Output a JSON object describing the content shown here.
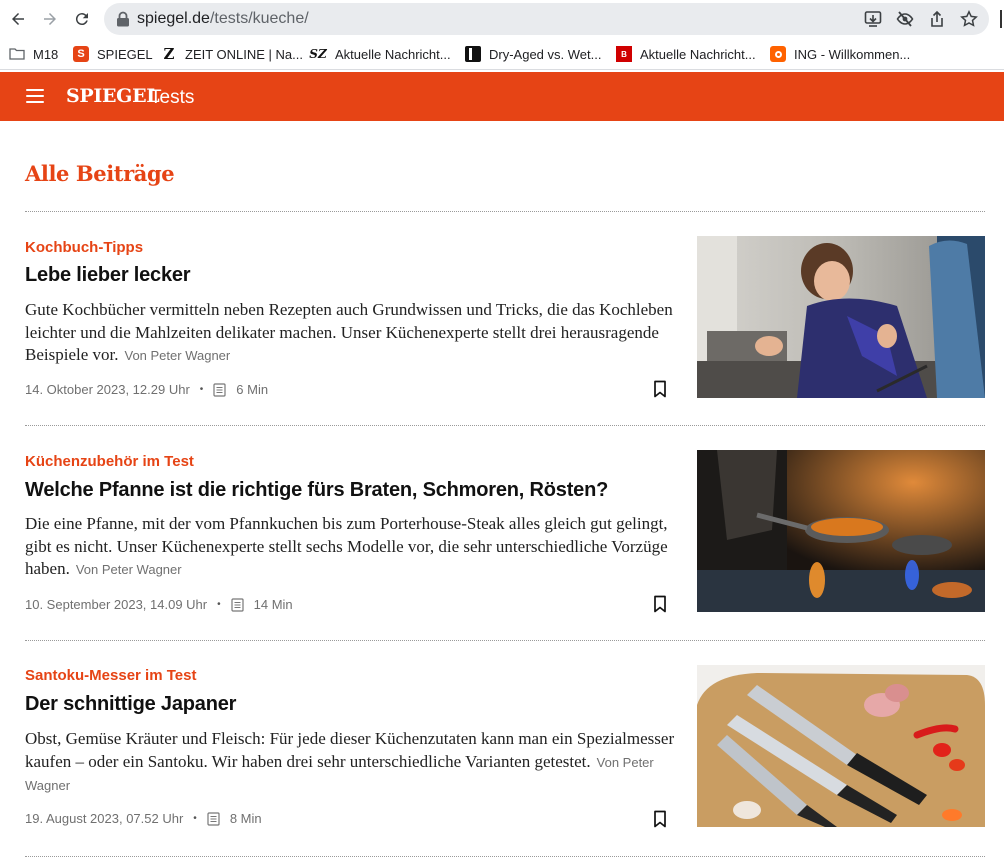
{
  "browser": {
    "url_host": "spiegel.de",
    "url_path": "/tests/kueche/",
    "bookmarks": [
      {
        "label": "M18",
        "icon": "folder-icon"
      },
      {
        "label": "SPIEGEL",
        "icon": "spiegel-favicon",
        "color": "#e64415"
      },
      {
        "label": "ZEIT ONLINE | Na...",
        "icon": "zeit-favicon"
      },
      {
        "label": "Aktuelle Nachricht...",
        "icon": "sz-favicon"
      },
      {
        "label": "Dry-Aged vs. Wet...",
        "icon": "book-favicon"
      },
      {
        "label": "Aktuelle Nachricht...",
        "icon": "bild-favicon",
        "color": "#d00000"
      },
      {
        "label": "ING - Willkommen...",
        "icon": "ing-favicon",
        "color": "#ff6200"
      }
    ]
  },
  "header": {
    "logo": "SPIEGEL",
    "section": "Tests",
    "color": "#e64415"
  },
  "page": {
    "title": "Alle Beiträge"
  },
  "articles": [
    {
      "kicker": "Kochbuch-Tipps",
      "headline": "Lebe lieber lecker",
      "teaser": "Gute Kochbücher vermitteln neben Rezepten auch Grundwissen und Tricks, die das Kochleben leichter und die Mahlzeiten delikater machen. Unser Küchenexperte stellt drei herausragende Beispiele vor.",
      "author": "Von Peter Wagner",
      "date": "14. Oktober 2023, 12.29 Uhr",
      "read_time": "6 Min",
      "image": "woman-cooking-photo"
    },
    {
      "kicker": "Küchenzubehör im Test",
      "headline": "Welche Pfanne ist die richtige fürs Braten, Schmoren, Rösten?",
      "teaser": "Die eine Pfanne, mit der vom Pfannkuchen bis zum Porterhouse-Steak alles gleich gut gelingt, gibt es nicht. Unser Küchenexperte stellt sechs Modelle vor, die sehr unterschiedliche Vorzüge haben.",
      "author": "Von Peter Wagner",
      "date": "10. September 2023, 14.09 Uhr",
      "read_time": "14 Min",
      "image": "pan-on-flame-photo"
    },
    {
      "kicker": "Santoku-Messer im Test",
      "headline": "Der schnittige Japaner",
      "teaser": "Obst, Gemüse Kräuter und Fleisch: Für jede dieser Küchenzutaten kann man ein Spezialmesser kaufen – oder ein Santoku. Wir haben drei sehr unterschiedliche Varianten getestet.",
      "author": "Von Peter Wagner",
      "date": "19. August 2023, 07.52 Uhr",
      "read_time": "8 Min",
      "image": "santoku-knives-photo"
    }
  ]
}
